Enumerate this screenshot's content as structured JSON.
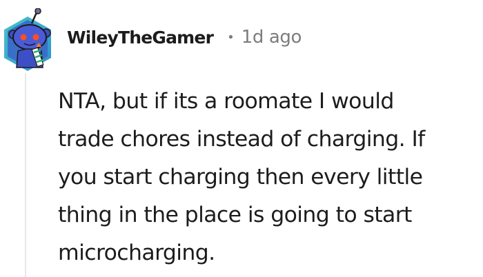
{
  "comment": {
    "author": "WileyTheGamer",
    "separator": "•",
    "timestamp": "1d ago",
    "body_lines": [
      "NTA, but if its a roomate I would",
      "trade chores instead of charging. If",
      "you start charging then every little",
      "thing in the place is going to start",
      "microcharging."
    ]
  },
  "avatar": {
    "icon": "snoo-avatar-icon",
    "frame_color": "#3fa7d6",
    "body_color": "#4a5bd8",
    "eye_color": "#ff4f1f"
  },
  "colors": {
    "text": "#1c1c1c",
    "meta": "#7c7c7c",
    "thread_line": "#e5e8eb"
  }
}
